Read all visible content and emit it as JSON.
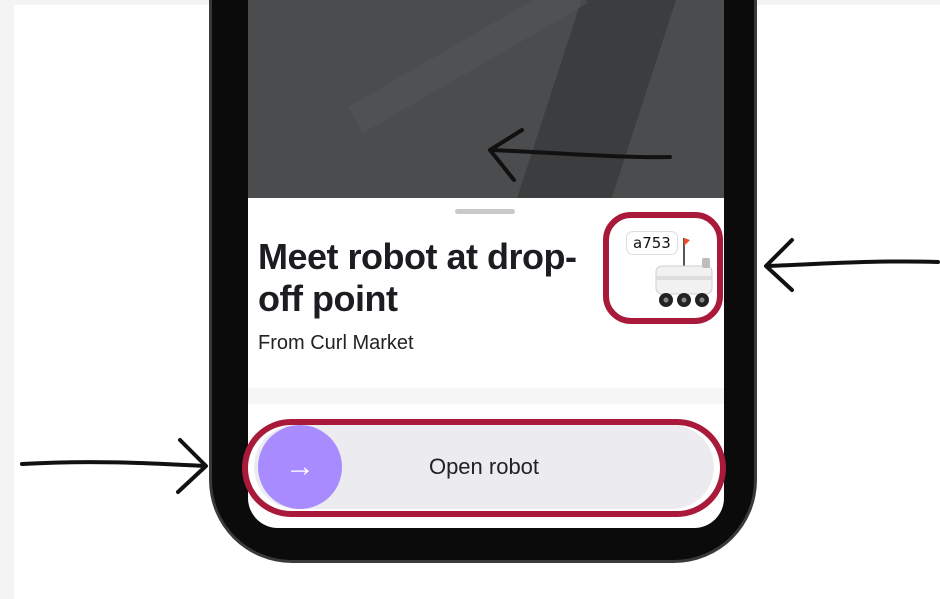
{
  "sheet": {
    "title": "Meet robot at drop-off point",
    "subtitle": "From Curl Market"
  },
  "robot": {
    "id_tag": "a753"
  },
  "action": {
    "slider_label": "Open robot",
    "knob_icon": "arrow-right-icon"
  },
  "colors": {
    "highlight": "#a8193a",
    "knob": "#a88cff",
    "map": "#4a4c4d"
  }
}
